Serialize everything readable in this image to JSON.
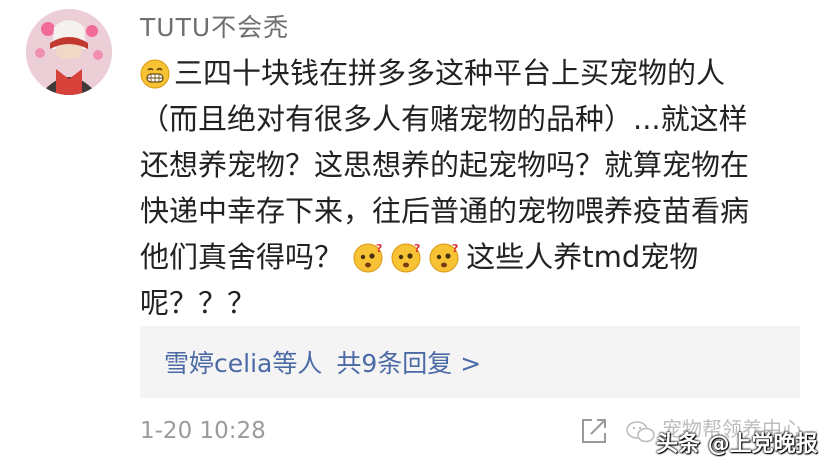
{
  "comment": {
    "username": "TUTU不会秃",
    "lines": [
      "三四十块钱在拼多多这种平台上买宠物的人",
      "（而且绝对有很多人有赌宠物的品种）...就这样",
      "还想养宠物？这思想养的起宠物吗？就算宠物在",
      "快递中幸存下来，往后普通的宠物喂养疫苗看病",
      "他们真舍得吗？",
      "这些人养tmd宠物",
      "呢？？？"
    ],
    "emojis": {
      "first": "grin-emoji",
      "inline": [
        "confused-emoji",
        "confused-emoji",
        "confused-emoji"
      ]
    },
    "replies": {
      "names": "雪婷celia等人",
      "count_label": "共9条回复 >"
    },
    "timestamp": "1-20 10:28"
  },
  "footer": {
    "account_name": "宠物帮领养中心",
    "watermark": "头条 @上党晚报"
  },
  "colors": {
    "link": "#4b6aa5",
    "meta": "#9b9b9b",
    "reply_bg": "#f4f4f4"
  }
}
